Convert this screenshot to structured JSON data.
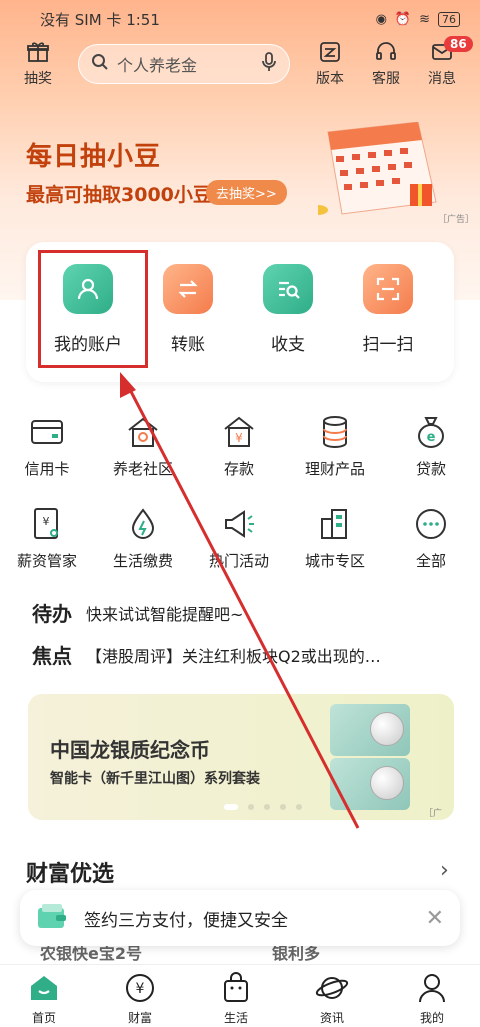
{
  "status_bar": {
    "carrier_time": "没有 SIM 卡 1:51",
    "battery": "76"
  },
  "top": {
    "lottery_label": "抽奖",
    "search_placeholder": "个人养老金",
    "version_label": "版本",
    "service_label": "客服",
    "message_label": "消息",
    "message_badge": "86"
  },
  "promo": {
    "title": "每日抽小豆",
    "subtitle": "最高可抽取3000小豆",
    "button": "去抽奖>>",
    "ad_tag": "［广告］"
  },
  "quick_actions": [
    {
      "label": "我的账户",
      "icon": "account-icon",
      "color": "green"
    },
    {
      "label": "转账",
      "icon": "transfer-icon",
      "color": "orange"
    },
    {
      "label": "收支",
      "icon": "income-expense-icon",
      "color": "green"
    },
    {
      "label": "扫一扫",
      "icon": "scan-icon",
      "color": "orange"
    }
  ],
  "services": [
    {
      "label": "信用卡",
      "icon": "credit-card-icon"
    },
    {
      "label": "养老社区",
      "icon": "pension-community-icon"
    },
    {
      "label": "存款",
      "icon": "deposit-icon"
    },
    {
      "label": "理财产品",
      "icon": "wealth-product-icon"
    },
    {
      "label": "贷款",
      "icon": "loan-icon"
    },
    {
      "label": "薪资管家",
      "icon": "salary-icon"
    },
    {
      "label": "生活缴费",
      "icon": "utility-icon"
    },
    {
      "label": "热门活动",
      "icon": "megaphone-icon"
    },
    {
      "label": "城市专区",
      "icon": "city-icon"
    },
    {
      "label": "全部",
      "icon": "more-icon"
    }
  ],
  "todo": {
    "tag": "待办",
    "text": "快来试试智能提醒吧~"
  },
  "focus": {
    "tag": "焦点",
    "text": "【港股周评】关注红利板块Q2或出现的…"
  },
  "banner": {
    "title": "中国龙银质纪念币",
    "subtitle": "智能卡（新千里江山图）系列套装",
    "ad_tag": "［广告］"
  },
  "wealth": {
    "title": "财富优选"
  },
  "toast": {
    "text": "签约三方支付，便捷又安全"
  },
  "peek": {
    "left": "农银快e宝2号",
    "right": "银利多"
  },
  "tabs": [
    {
      "label": "首页",
      "icon": "home-icon",
      "active": true
    },
    {
      "label": "财富",
      "icon": "yuan-icon",
      "active": false
    },
    {
      "label": "生活",
      "icon": "shopping-bag-icon",
      "active": false
    },
    {
      "label": "资讯",
      "icon": "planet-icon",
      "active": false
    },
    {
      "label": "我的",
      "icon": "user-icon",
      "active": false
    }
  ],
  "colors": {
    "accent_green": "#2fae88",
    "accent_orange": "#f47c4c",
    "annotation_red": "#d62d2d"
  }
}
